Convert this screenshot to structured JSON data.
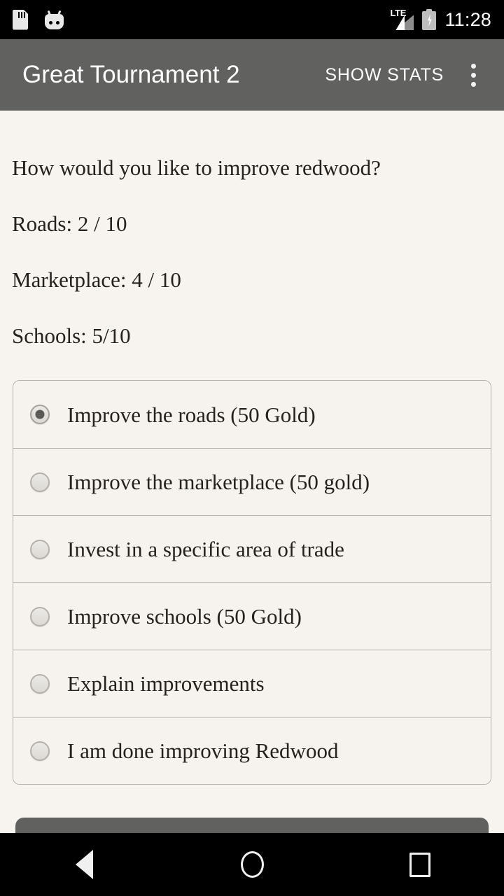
{
  "status_bar": {
    "icons_left": [
      "sdcard-icon",
      "android-bugdroid-icon"
    ],
    "network_label": "LTE",
    "icons_right": [
      "signal-icon",
      "battery-charging-icon"
    ],
    "time": "11:28"
  },
  "app_bar": {
    "title": "Great Tournament 2",
    "action_label": "SHOW STATS",
    "overflow_icon": "more-vert-icon"
  },
  "content": {
    "prompt": "How would you like to improve redwood?",
    "stats": [
      "Roads: 2 / 10",
      "Marketplace: 4 / 10",
      "Schools: 5/10"
    ],
    "options": [
      {
        "label": "Improve the roads (50 Gold)",
        "selected": true
      },
      {
        "label": "Improve the marketplace (50 gold)",
        "selected": false
      },
      {
        "label": "Invest in a specific area of trade",
        "selected": false
      },
      {
        "label": "Improve schools (50 Gold)",
        "selected": false
      },
      {
        "label": "Explain improvements",
        "selected": false
      },
      {
        "label": "I am done improving Redwood",
        "selected": false
      }
    ],
    "bottom_button_label": ""
  },
  "nav_bar": {
    "back": "back-icon",
    "home": "home-icon",
    "recents": "recents-icon"
  },
  "colors": {
    "app_bar": "#616160",
    "status_bar": "#000000",
    "page_background": "#f7f4ef",
    "card_border": "#b6b2ab",
    "text": "#25221e"
  }
}
